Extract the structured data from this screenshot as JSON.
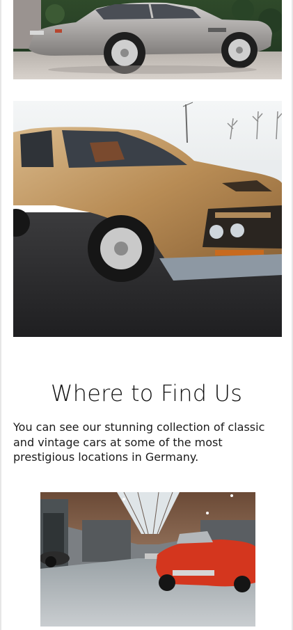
{
  "gallery": {
    "images": [
      {
        "name": "silver-classic-coupe-photo"
      },
      {
        "name": "gold-classic-sports-car-photo"
      }
    ]
  },
  "location": {
    "title": "Where to Find Us",
    "text": "You can see our stunning collection of classic and vintage cars at some of the most prestigious locations in Germany.",
    "image": {
      "name": "car-exhibition-hall-photo"
    }
  }
}
